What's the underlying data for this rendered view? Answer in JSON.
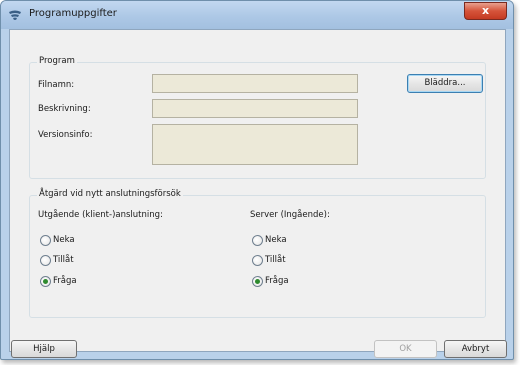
{
  "window": {
    "title": "Programuppgifter",
    "close_label": "x"
  },
  "program_group": {
    "title": "Program",
    "filename_label": "Filnamn:",
    "filename_value": "",
    "description_label": "Beskrivning:",
    "description_value": "",
    "version_label": "Versionsinfo:",
    "version_value": "",
    "browse_label": "Bläddra..."
  },
  "action_group": {
    "title": "Åtgärd vid nytt anslutningsförsök",
    "outgoing": {
      "heading": "Utgående (klient-)anslutning:",
      "options": [
        "Neka",
        "Tillåt",
        "Fråga"
      ],
      "selected": "Fråga"
    },
    "server": {
      "heading": "Server (Ingående):",
      "options": [
        "Neka",
        "Tillåt",
        "Fråga"
      ],
      "selected": "Fråga"
    }
  },
  "footer": {
    "help_label": "Hjälp",
    "ok_label": "OK",
    "cancel_label": "Avbryt"
  },
  "colors": {
    "radio_selected": "#2e8a2e",
    "field_background": "#ece9d8",
    "close_button": "#c43a22"
  }
}
